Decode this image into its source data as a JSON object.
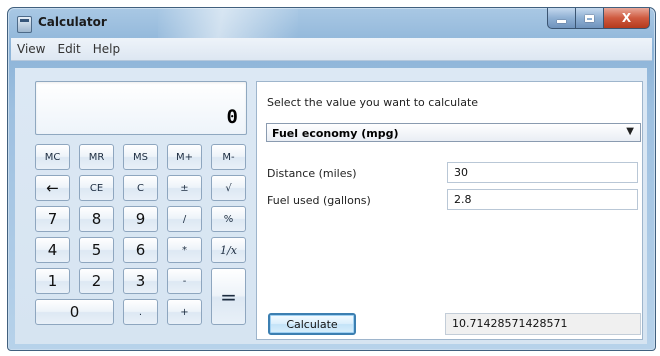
{
  "window": {
    "title": "Calculator"
  },
  "caption": {
    "close_label": "X"
  },
  "menu": [
    "View",
    "Edit",
    "Help"
  ],
  "display": {
    "value": "0"
  },
  "keypad": {
    "mc": "MC",
    "mr": "MR",
    "ms": "MS",
    "mplus": "M+",
    "mminus": "M-",
    "back": "←",
    "ce": "CE",
    "c": "C",
    "plusminus": "±",
    "sqrt": "√",
    "d7": "7",
    "d8": "8",
    "d9": "9",
    "div": "/",
    "pct": "%",
    "d4": "4",
    "d5": "5",
    "d6": "6",
    "mul": "*",
    "recip": "1/x",
    "d1": "1",
    "d2": "2",
    "d3": "3",
    "sub": "-",
    "eq": "=",
    "d0": "0",
    "dot": ".",
    "add": "+"
  },
  "fuel": {
    "prompt": "Select the value you want to calculate",
    "mode": "Fuel economy (mpg)",
    "distance_label": "Distance (miles)",
    "distance_value": "30",
    "fuel_label": "Fuel used (gallons)",
    "fuel_value": "2.8",
    "calculate_label": "Calculate",
    "result": "10.71428571428571"
  }
}
